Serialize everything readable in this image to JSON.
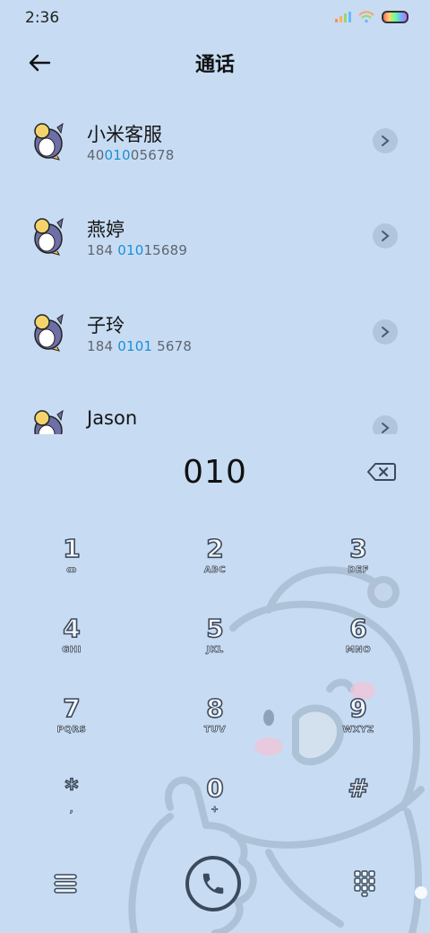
{
  "status_bar": {
    "time": "2:36"
  },
  "header": {
    "title": "通话",
    "back_icon": "arrow-left-icon"
  },
  "contacts": [
    {
      "name": "小米客服",
      "number_pre": "40",
      "number_match": "010",
      "number_post": "05678"
    },
    {
      "name": "燕婷",
      "number_pre": "184 ",
      "number_match": "010",
      "number_post": "15689"
    },
    {
      "name": "子玲",
      "number_pre": "184 ",
      "number_match": "0101",
      "number_post": " 5678"
    },
    {
      "name": "Jason",
      "number_pre": "",
      "number_match": "",
      "number_post": ""
    }
  ],
  "dialer": {
    "input": "010"
  },
  "keypad": [
    {
      "digit": "1",
      "letters": "ꝏ"
    },
    {
      "digit": "2",
      "letters": "ABC"
    },
    {
      "digit": "3",
      "letters": "DEF"
    },
    {
      "digit": "4",
      "letters": "GHI"
    },
    {
      "digit": "5",
      "letters": "JKL"
    },
    {
      "digit": "6",
      "letters": "MNO"
    },
    {
      "digit": "7",
      "letters": "PQRS"
    },
    {
      "digit": "8",
      "letters": "TUV"
    },
    {
      "digit": "9",
      "letters": "WXYZ"
    },
    {
      "digit": "*",
      "letters": ","
    },
    {
      "digit": "0",
      "letters": "+"
    },
    {
      "digit": "#",
      "letters": ""
    }
  ],
  "colors": {
    "background": "#c7dcf3",
    "match_highlight": "#1b8fd6",
    "outline": "#3c4a5d"
  }
}
